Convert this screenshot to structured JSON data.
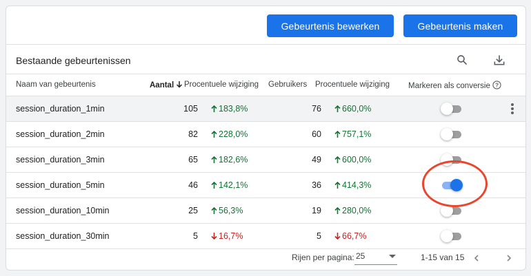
{
  "toolbar": {
    "edit_label": "Gebeurtenis bewerken",
    "create_label": "Gebeurtenis maken"
  },
  "section": {
    "title": "Bestaande gebeurtenissen",
    "search_icon": "search-icon",
    "download_icon": "download-icon"
  },
  "table": {
    "columns": {
      "name": "Naam van gebeurtenis",
      "count": "Aantal",
      "count_change": "Procentuele wijziging",
      "users": "Gebruikers",
      "users_change": "Procentuele wijziging",
      "conversion": "Markeren als conversie"
    },
    "rows": [
      {
        "name": "session_duration_1min",
        "count": "105",
        "count_change": "183,8%",
        "count_dir": "up",
        "users": "76",
        "users_change": "660,0%",
        "users_dir": "up",
        "conversion": false
      },
      {
        "name": "session_duration_2min",
        "count": "82",
        "count_change": "228,0%",
        "count_dir": "up",
        "users": "60",
        "users_change": "757,1%",
        "users_dir": "up",
        "conversion": false
      },
      {
        "name": "session_duration_3min",
        "count": "65",
        "count_change": "182,6%",
        "count_dir": "up",
        "users": "49",
        "users_change": "600,0%",
        "users_dir": "up",
        "conversion": false
      },
      {
        "name": "session_duration_5min",
        "count": "46",
        "count_change": "142,1%",
        "count_dir": "up",
        "users": "36",
        "users_change": "414,3%",
        "users_dir": "up",
        "conversion": true
      },
      {
        "name": "session_duration_10min",
        "count": "25",
        "count_change": "56,3%",
        "count_dir": "up",
        "users": "19",
        "users_change": "280,0%",
        "users_dir": "up",
        "conversion": false
      },
      {
        "name": "session_duration_30min",
        "count": "5",
        "count_change": "16,7%",
        "count_dir": "down",
        "users": "5",
        "users_change": "66,7%",
        "users_dir": "down",
        "conversion": false
      }
    ]
  },
  "footer": {
    "rows_per_page_label": "Rijen per pagina:",
    "rows_per_page_value": "25",
    "range": "1-15 van 15"
  },
  "colors": {
    "accent": "#1a73e8",
    "positive": "#137333",
    "negative": "#c5221f",
    "highlight": "#e8472d"
  }
}
